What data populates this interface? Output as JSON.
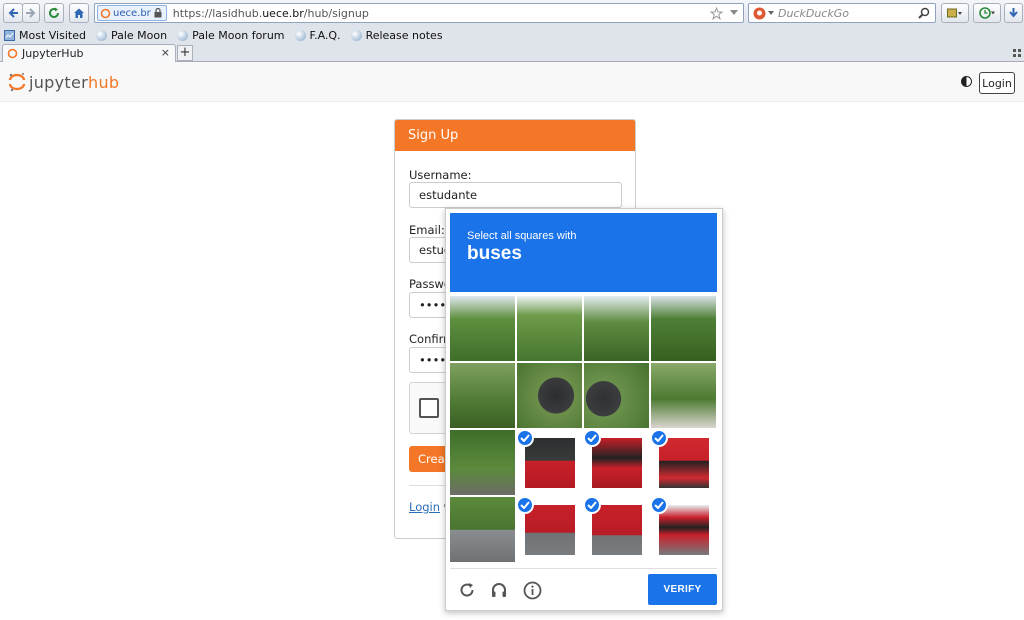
{
  "browser": {
    "url_site_id": "uece.br",
    "url_prefix": "https://lasidhub.",
    "url_domain": "uece.br",
    "url_path": "/hub/signup",
    "search_placeholder": "DuckDuckGo",
    "bookmarks": [
      "Most Visited",
      "Pale Moon",
      "Pale Moon forum",
      "F.A.Q.",
      "Release notes"
    ],
    "tab_title": "JupyterHub",
    "tab_close": "×",
    "new_tab": "+"
  },
  "header": {
    "logo_jupyter": "jupyter",
    "logo_hub": "hub",
    "login_label": "Login"
  },
  "signup": {
    "title": "Sign Up",
    "username_label": "Username:",
    "username_value": "estudante",
    "email_label": "Email:",
    "email_value": "estud",
    "password_label": "Passwo",
    "password_value": "••••",
    "confirm_label": "Confirm",
    "confirm_value": "••••",
    "create_label": "Creat",
    "login_link": "Login",
    "login_suffix": " w"
  },
  "captcha": {
    "instruction": "Select all squares with",
    "target": "buses",
    "verify_label": "VERIFY",
    "tiles_selected": [
      false,
      false,
      false,
      false,
      false,
      false,
      false,
      false,
      false,
      true,
      true,
      true,
      false,
      true,
      true,
      true
    ],
    "accent_color": "#1a73e8"
  },
  "colors": {
    "jupyter_orange": "#f37726",
    "recaptcha_blue": "#1a73e8"
  }
}
